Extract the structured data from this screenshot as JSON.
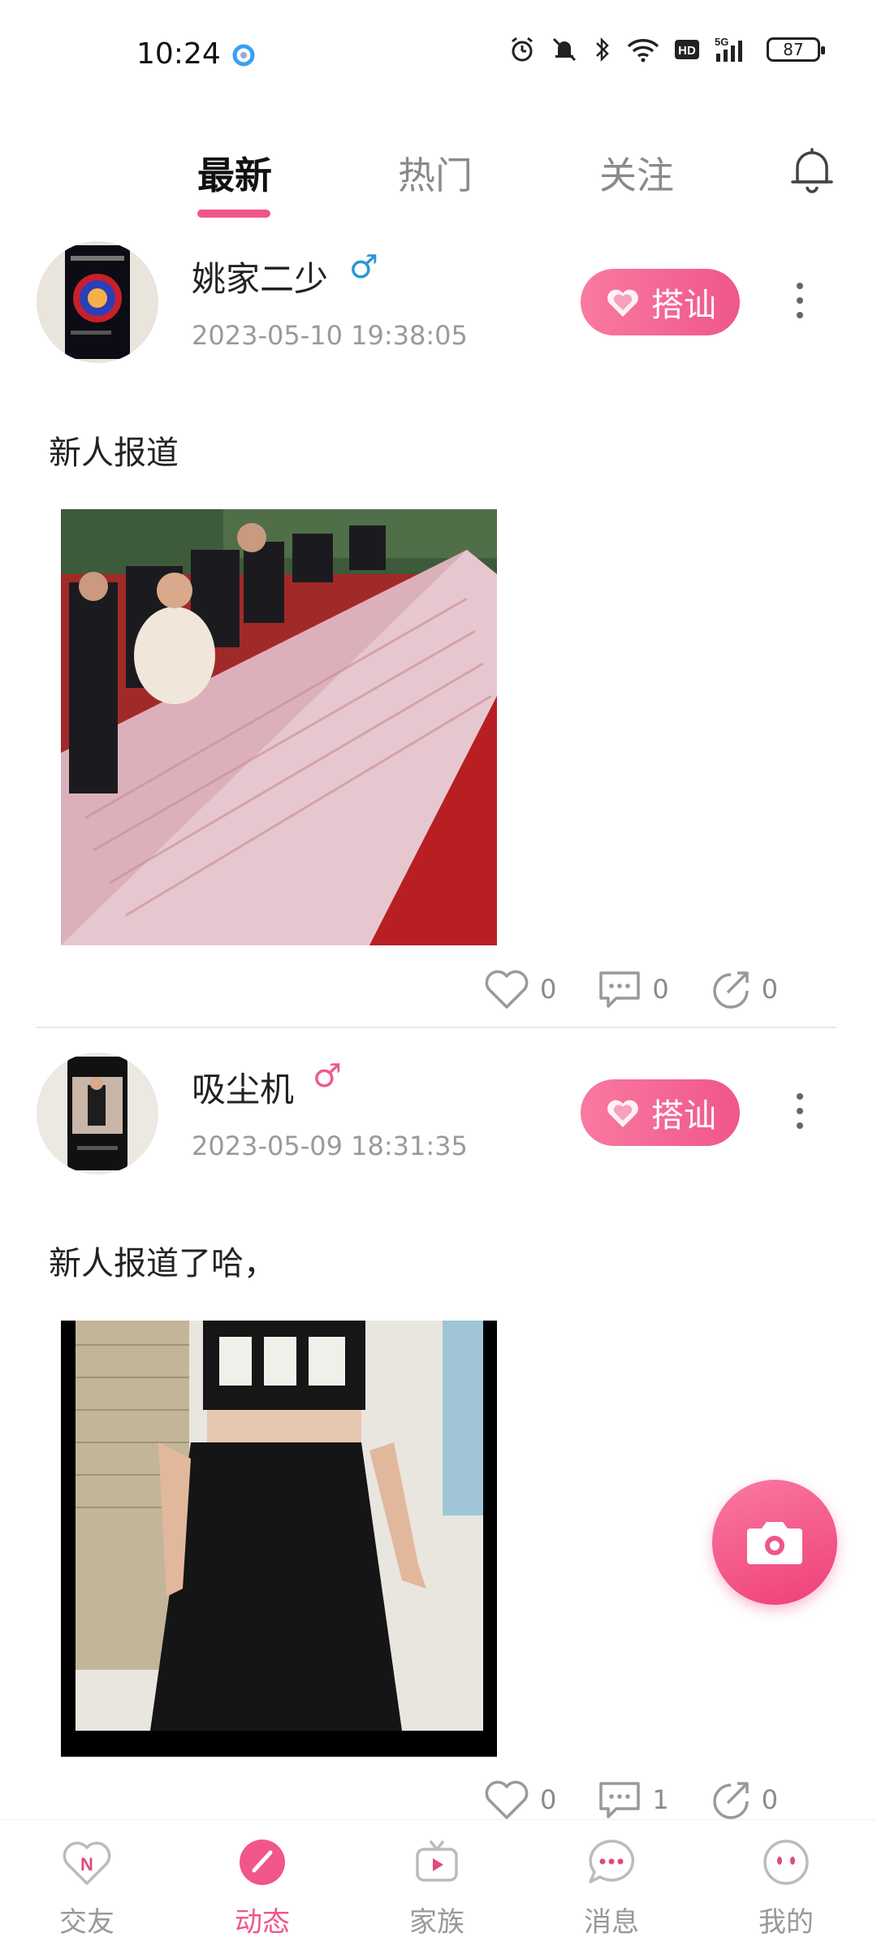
{
  "status_bar": {
    "time": "10:24",
    "battery": "87"
  },
  "tabs": [
    {
      "label": "最新"
    },
    {
      "label": "热门"
    },
    {
      "label": "关注"
    }
  ],
  "posts": [
    {
      "username": "姚家二少",
      "gender_symbol": "♂",
      "time": "2023-05-10 19:38:05",
      "flirt_button": "搭讪",
      "text": "新人报道",
      "likes": "0",
      "comments": "0",
      "shares": "0"
    },
    {
      "username": "吸尘机",
      "gender_symbol": "♂",
      "time": "2023-05-09 18:31:35",
      "flirt_button": "搭讪",
      "text": "新人报道了哈，",
      "likes": "0",
      "comments": "1",
      "shares": "0"
    }
  ],
  "bottom_nav": [
    {
      "label": "交友",
      "icon": "heart-n-icon"
    },
    {
      "label": "动态",
      "icon": "pencil-icon"
    },
    {
      "label": "家族",
      "icon": "tv-icon"
    },
    {
      "label": "消息",
      "icon": "chat-icon"
    },
    {
      "label": "我的",
      "icon": "face-icon"
    }
  ],
  "colors": {
    "accent": "#f0568b",
    "male_blue": "#2b95d6",
    "gender_pink": "#f05a8a"
  }
}
